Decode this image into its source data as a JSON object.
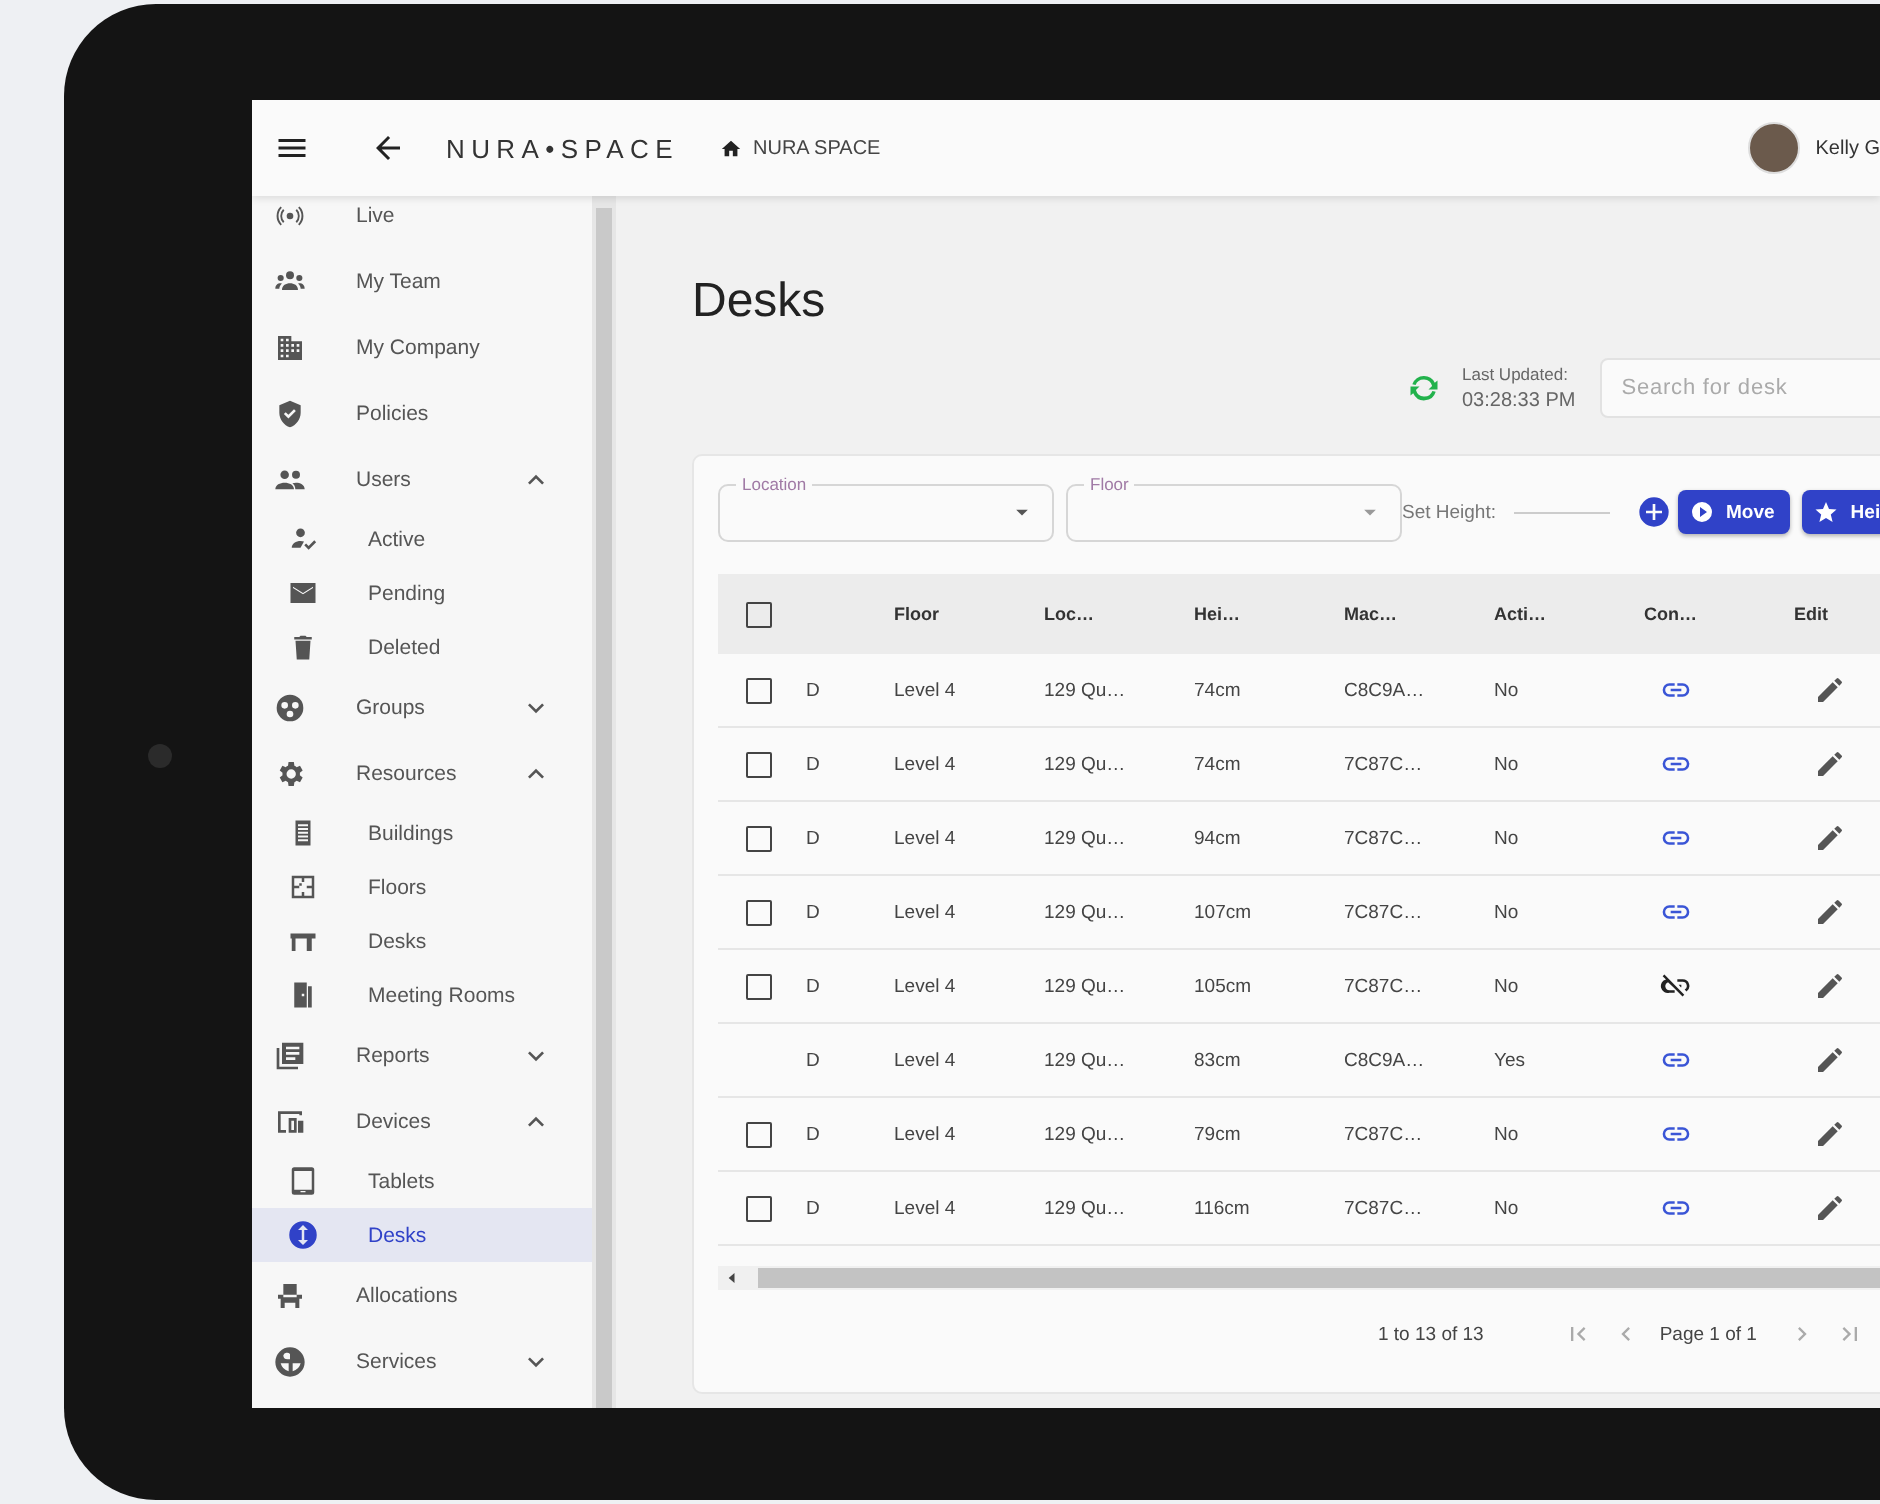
{
  "header": {
    "logo": "NURA•SPACE",
    "breadcrumb": "NURA SPACE",
    "user_name": "Kelly G"
  },
  "sidebar": {
    "items": [
      {
        "label": "Live",
        "kind": "link",
        "selected": false
      },
      {
        "label": "My Team",
        "kind": "link",
        "selected": false
      },
      {
        "label": "My Company",
        "kind": "link",
        "selected": false
      },
      {
        "label": "Policies",
        "kind": "link",
        "selected": false
      },
      {
        "label": "Users",
        "kind": "group",
        "selected": false,
        "expanded": true,
        "children": [
          {
            "label": "Active",
            "selected": false
          },
          {
            "label": "Pending",
            "selected": false
          },
          {
            "label": "Deleted",
            "selected": false
          }
        ]
      },
      {
        "label": "Groups",
        "kind": "group",
        "selected": false,
        "expanded": false
      },
      {
        "label": "Resources",
        "kind": "group",
        "selected": false,
        "expanded": true,
        "children": [
          {
            "label": "Buildings",
            "selected": false
          },
          {
            "label": "Floors",
            "selected": false
          },
          {
            "label": "Desks",
            "selected": false
          },
          {
            "label": "Meeting Rooms",
            "selected": false
          }
        ]
      },
      {
        "label": "Reports",
        "kind": "group",
        "selected": false,
        "expanded": false
      },
      {
        "label": "Devices",
        "kind": "group",
        "selected": false,
        "expanded": true,
        "children": [
          {
            "label": "Tablets",
            "selected": false
          },
          {
            "label": "Desks",
            "selected": true
          }
        ]
      },
      {
        "label": "Allocations",
        "kind": "link",
        "selected": false
      },
      {
        "label": "Services",
        "kind": "group",
        "selected": false,
        "expanded": false
      }
    ]
  },
  "page": {
    "title": "Desks",
    "last_updated_label": "Last Updated:",
    "last_updated_time": "03:28:33 PM",
    "search": {
      "placeholder": "Search for desk"
    }
  },
  "filters": {
    "location": {
      "label": "Location"
    },
    "floor": {
      "label": "Floor"
    },
    "set_height_label": "Set Height:",
    "buttons": [
      "Move",
      "Hei"
    ]
  },
  "table": {
    "header_checked": false,
    "columns": [
      "Floor",
      "Loc…",
      "Hei…",
      "Mac…",
      "Acti…",
      "Con…",
      "Edit"
    ],
    "rows": [
      {
        "kind": "checkbox",
        "checked": false,
        "type": "D",
        "floor": "Level 4",
        "location": "129 Qu…",
        "height": "74cm",
        "mac": "C8C9A…",
        "active": "No",
        "connected": true
      },
      {
        "kind": "checkbox",
        "checked": false,
        "type": "D",
        "floor": "Level 4",
        "location": "129 Qu…",
        "height": "74cm",
        "mac": "7C87C…",
        "active": "No",
        "connected": true
      },
      {
        "kind": "checkbox",
        "checked": false,
        "type": "D",
        "floor": "Level 4",
        "location": "129 Qu…",
        "height": "94cm",
        "mac": "7C87C…",
        "active": "No",
        "connected": true
      },
      {
        "kind": "checkbox",
        "checked": false,
        "type": "D",
        "floor": "Level 4",
        "location": "129 Qu…",
        "height": "107cm",
        "mac": "7C87C…",
        "active": "No",
        "connected": true
      },
      {
        "kind": "checkbox",
        "checked": false,
        "type": "D",
        "floor": "Level 4",
        "location": "129 Qu…",
        "height": "105cm",
        "mac": "7C87C…",
        "active": "No",
        "connected": false
      },
      {
        "kind": "plain",
        "type": "D",
        "floor": "Level 4",
        "location": "129 Qu…",
        "height": "83cm",
        "mac": "C8C9A…",
        "active": "Yes",
        "connected": true
      },
      {
        "kind": "checkbox",
        "checked": false,
        "type": "D",
        "floor": "Level 4",
        "location": "129 Qu…",
        "height": "79cm",
        "mac": "7C87C…",
        "active": "No",
        "connected": true
      },
      {
        "kind": "checkbox",
        "checked": false,
        "type": "D",
        "floor": "Level 4",
        "location": "129 Qu…",
        "height": "116cm",
        "mac": "7C87C…",
        "active": "No",
        "connected": true
      }
    ],
    "range": "1 to 13 of 13",
    "page_label": "Page 1 of 1"
  }
}
